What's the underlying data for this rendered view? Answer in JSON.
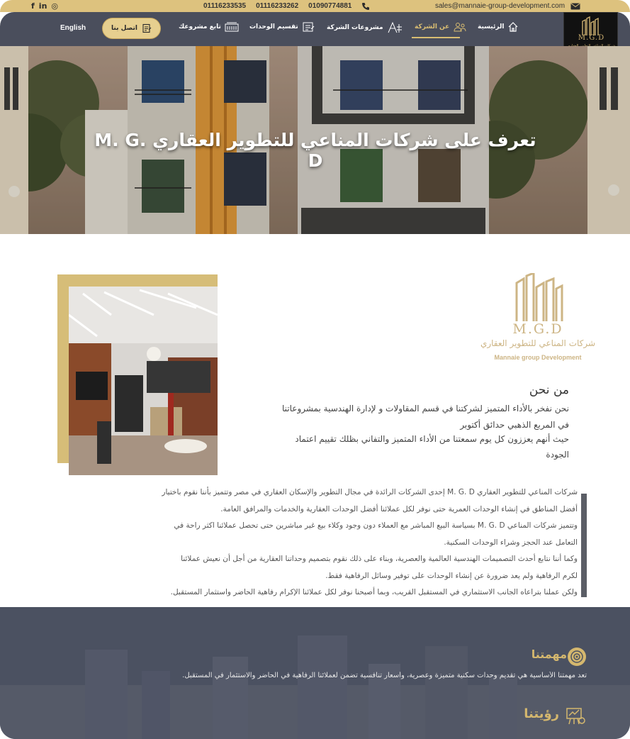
{
  "topbar": {
    "social": [
      "f",
      "in",
      "◎"
    ],
    "phones": [
      "01116233535",
      "01116233262",
      "01090774881"
    ],
    "email": "sales@mannaie-group-development.com"
  },
  "nav": {
    "english": "English",
    "contact": "اتصل بنا",
    "items": [
      {
        "label": "تابع مشروعك"
      },
      {
        "label": "تقسيم الوحدات"
      },
      {
        "label": "مشروعات الشركة"
      },
      {
        "label": "عن الشركة"
      },
      {
        "label": "الرئيسية"
      }
    ],
    "logo": {
      "mgd": "M.G.D",
      "ar": "شركات المناعي للتطوير العقاري",
      "en": "Mannaie group Development"
    }
  },
  "hero": {
    "title": "تعرف على شركات المناعي للتطوير العقاري M. G. D"
  },
  "about": {
    "logo": {
      "mgd": "M.G.D",
      "ar": "شركات المناعي للتطوير العقاري",
      "en": "Mannaie group Development"
    },
    "heading": "من نحن",
    "para_lines": [
      "نحن نفخر بالأداء المتميز لشركتنا في قسم المقاولات و لإدارة الهندسية بمشروعاتنا",
      "في المربع الذهبي حدائق أكتوبر",
      "حيث أنهم يعززون كل يوم سمعتنا من الأداء المتميز والتفاني بظلك تقييم اعتماد",
      "الجودة"
    ],
    "desc_lines": [
      "شركات المناعي للتطوير العقاري M. G. D إحدى الشركات الرائدة في مجال التطوير والإسكان العقاري في مصر وتتميز بأننا نقوم باختيار",
      "أفضل المناطق في إنشاء الوحدات العمرية حتى نوفر لكل عملائنا أفضل الوحدات العقارية والخدمات والمرافق العامة.",
      "وتتميز شركات المناعي M. G. D بسياسة البيع المباشر مع العملاء دون وجود وكلاء بيع غير مباشرين حتى تحصل عملائنا اكثر راحة في",
      "التعامل عند الحجز وشراء الوحدات السكنية.",
      "وكما أننا نتابع أحدث التصميمات الهندسية العالمية والعصرية، وبناء على ذلك نقوم بتصميم وحداتنا العقارية من أجل أن نعيش عملائنا",
      "لكرم الرفاهية ولم يعد ضرورة عن إنشاء الوحدات على توفير وسائل الرفاهية فقط.",
      "ولكن عملنا بتراعاه الجانب الاستثماري في المستقبل القريب، وبما أصبحنا نوفر لكل عملائنا الإكرام رفاهية الحاضر واستثمار المستقبل."
    ]
  },
  "mission": {
    "title": "مهمتنا",
    "text": "تعد مهمتنا الأساسية هي تقديم وحدات سكنية متميزة وعصرية، وأسعار تنافسية تضمن لعملائنا الرفاهية في الحاضر والاستثمار في المستقبل.",
    "vision_title": "رؤيتنا"
  }
}
